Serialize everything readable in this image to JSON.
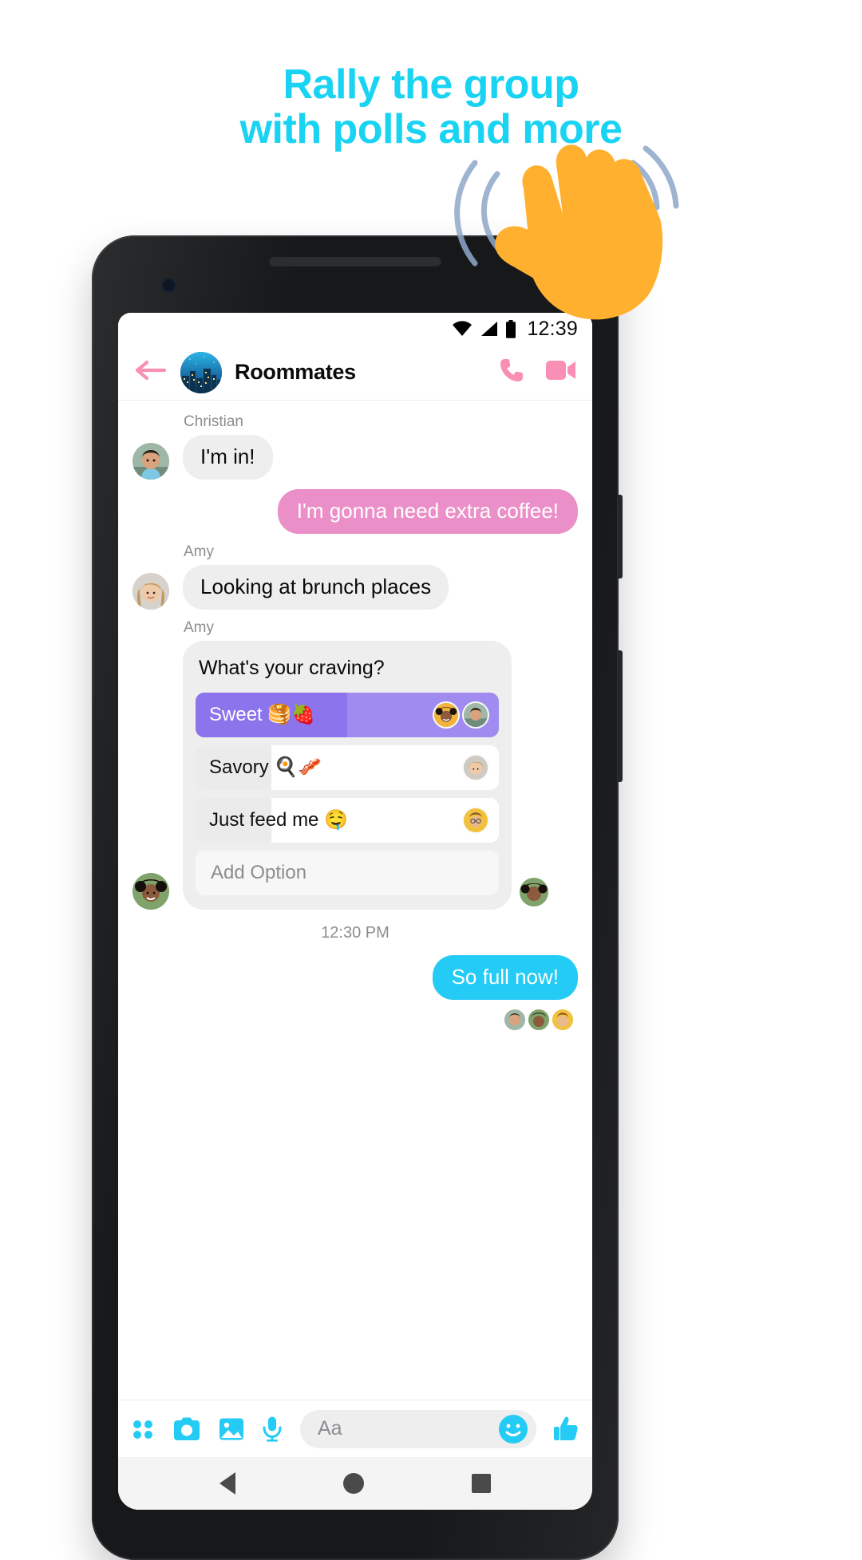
{
  "promo": {
    "headline_line1": "Rally the group",
    "headline_line2": "with polls and more",
    "accent_color": "#19D3F3",
    "wave_emoji": "wave-hand-emoji"
  },
  "statusbar": {
    "time": "12:39",
    "icons": [
      "wifi-icon",
      "cellular-signal-icon",
      "battery-icon"
    ]
  },
  "chat_header": {
    "back_icon": "back-arrow-icon",
    "title": "Roommates",
    "avatar": "group-avatar-city-skyline",
    "call_icon": "phone-call-icon",
    "video_icon": "video-call-icon",
    "accent_color": "#F98FB4"
  },
  "messages": [
    {
      "type": "incoming",
      "sender": "Christian",
      "text": "I'm in!",
      "avatar": "christian-avatar"
    },
    {
      "type": "outgoing_pink",
      "text": "I'm gonna need extra coffee!"
    },
    {
      "type": "incoming",
      "sender": "Amy",
      "text": "Looking at brunch places",
      "avatar": "amy-avatar"
    }
  ],
  "poll": {
    "sender": "Amy",
    "question": "What's your craving?",
    "options": [
      {
        "label": "Sweet 🥞🍓",
        "percent": 50,
        "voted": true,
        "voters": [
          "voter-jade",
          "voter-chris"
        ]
      },
      {
        "label": "Savory 🍳🥓",
        "percent": 25,
        "voted": false,
        "voters": [
          "voter-amy"
        ]
      },
      {
        "label": "Just feed me 🤤",
        "percent": 25,
        "voted": false,
        "voters": [
          "voter-sam"
        ]
      }
    ],
    "add_option_label": "Add Option",
    "left_avatar": "jade-avatar",
    "right_avatar": "jade-avatar-small",
    "voted_color": "#A08CF0",
    "voted_fill_color": "#8B74EC"
  },
  "timestamp": "12:30 PM",
  "last_message": {
    "type": "outgoing_blue",
    "text": "So full now!"
  },
  "seen_by": [
    "seen-chris",
    "seen-jade",
    "seen-sam"
  ],
  "composer": {
    "icons": [
      "apps-grid-icon",
      "camera-icon",
      "gallery-icon",
      "microphone-icon"
    ],
    "placeholder": "Aa",
    "emoji_icon": "smiley-face-icon",
    "thumbs_icon": "thumbs-up-icon",
    "accent_color": "#24CBF5"
  },
  "navbar": {
    "back": "android-back-button",
    "home": "android-home-button",
    "recents": "android-recents-button"
  }
}
